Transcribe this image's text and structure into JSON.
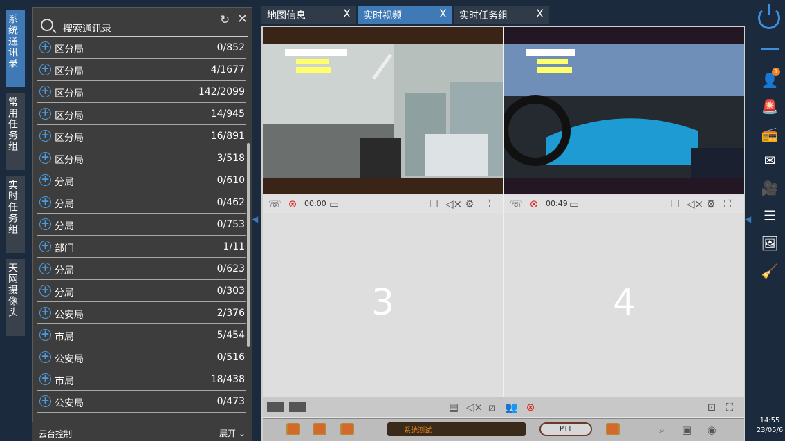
{
  "vtabs": [
    "系统通讯录",
    "常用任务组",
    "实时任务组",
    "天网摄像头"
  ],
  "search": {
    "placeholder": "搜索通讯录"
  },
  "contacts": [
    {
      "label": "区分局",
      "count": "0/852"
    },
    {
      "label": "区分局",
      "count": "4/1677"
    },
    {
      "label": "区分局",
      "count": "142/2099"
    },
    {
      "label": "区分局",
      "count": "14/945"
    },
    {
      "label": "区分局",
      "count": "16/891"
    },
    {
      "label": "区分局",
      "count": "3/518"
    },
    {
      "label": "分局",
      "count": "0/610"
    },
    {
      "label": "分局",
      "count": "0/462"
    },
    {
      "label": "分局",
      "count": "0/753"
    },
    {
      "label": "部门",
      "count": "1/11"
    },
    {
      "label": "分局",
      "count": "0/623"
    },
    {
      "label": "分局",
      "count": "0/303"
    },
    {
      "label": "公安局",
      "count": "2/376"
    },
    {
      "label": "市局",
      "count": "5/454"
    },
    {
      "label": "公安局",
      "count": "0/516"
    },
    {
      "label": "市局",
      "count": "18/438"
    },
    {
      "label": "公安局",
      "count": "0/473"
    }
  ],
  "ptz": {
    "label": "云台控制",
    "expand": "展开"
  },
  "tabs": [
    {
      "label": "地图信息",
      "close": "X"
    },
    {
      "label": "实时视频",
      "close": "X"
    },
    {
      "label": "实时任务组",
      "close": "X"
    }
  ],
  "cells": {
    "cell1_time": "00:00",
    "cell2_time": "00:49",
    "cell3_num": "3",
    "cell4_num": "4"
  },
  "control": {
    "status": "系统测试",
    "ptt": "PTT"
  },
  "right": {
    "badge": "1",
    "time": "14:55",
    "date": "23/05/6"
  },
  "colors": {
    "accent": "#3f7ab7",
    "bg": "#1b2a3c"
  }
}
